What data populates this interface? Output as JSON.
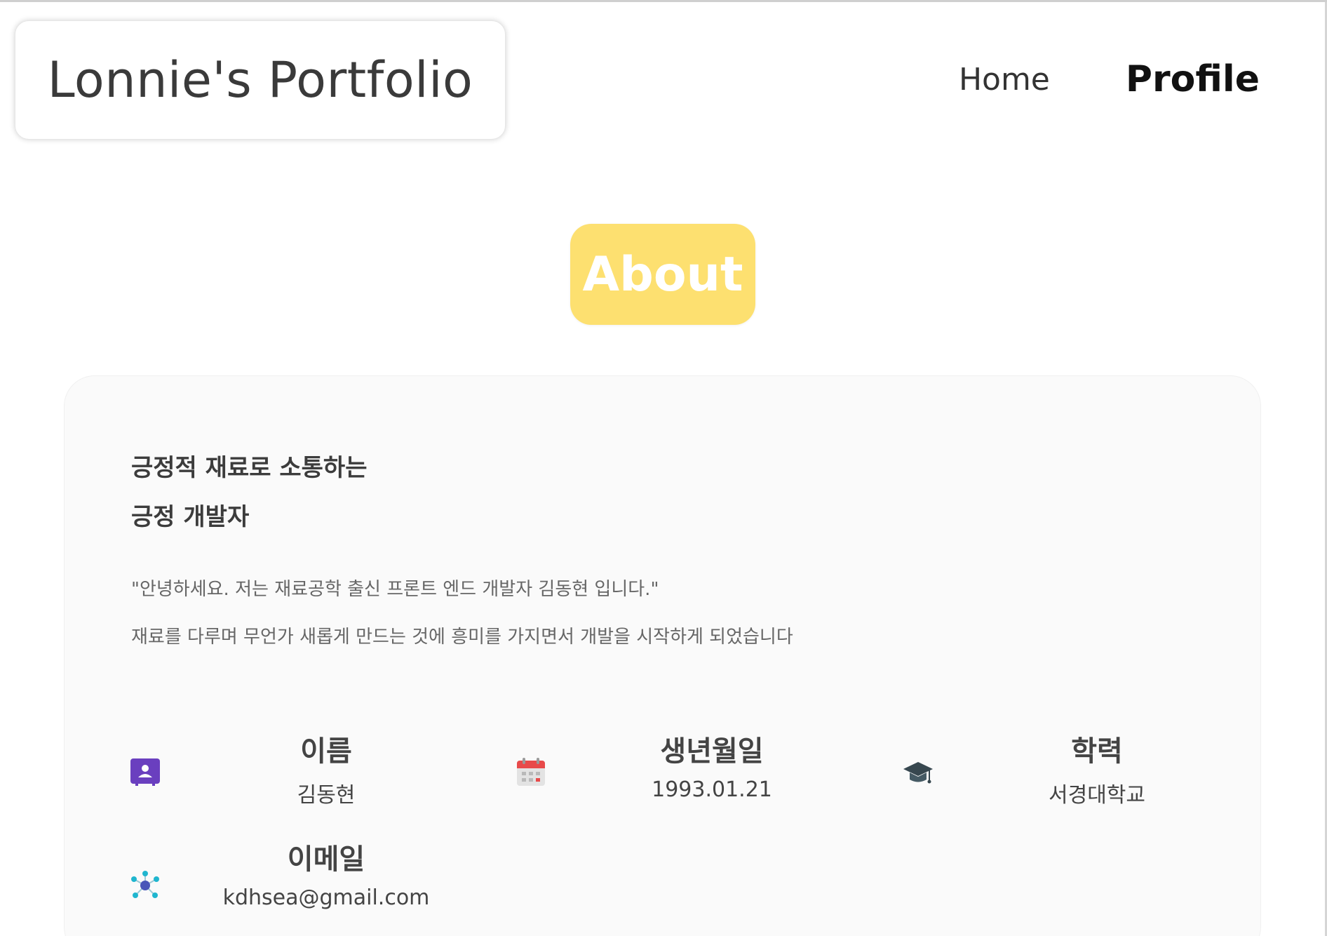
{
  "header": {
    "logo_text": "Lonnie's Portfolio",
    "nav": [
      {
        "label": "Home"
      },
      {
        "label": "Profile"
      }
    ]
  },
  "about": {
    "badge": "About",
    "badge_color": "#fde070"
  },
  "card": {
    "headline_line1": "긍정적 재료로 소통하는",
    "headline_line2": "긍정 개발자",
    "intro_line1": "\"안녕하세요. 저는 재료공학 출신 프론트 엔드 개발자 김동현 입니다.\"",
    "intro_line2": "재료를 다루며 무언가 새롭게 만드는 것에 흥미를 가지면서 개발을 시작하게 되었습니다",
    "info": [
      {
        "icon": "contact-card-icon",
        "title": "이름",
        "value": "김동현"
      },
      {
        "icon": "calendar-icon",
        "title": "생년월일",
        "value": "1993.01.21"
      },
      {
        "icon": "graduation-cap-icon",
        "title": "학력",
        "value": "서경대학교"
      },
      {
        "icon": "network-icon",
        "title": "이메일",
        "value": "kdhsea@gmail.com"
      }
    ]
  }
}
